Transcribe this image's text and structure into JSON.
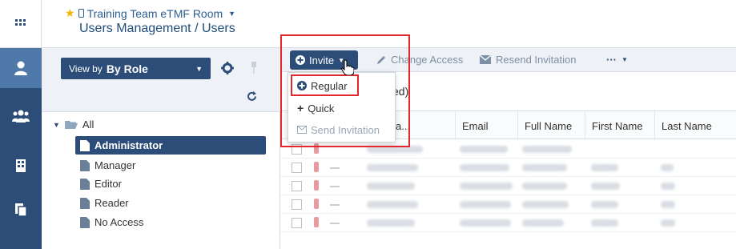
{
  "app": {
    "room_name": "Training Team eTMF Room",
    "page_title": "Users Management / Users"
  },
  "nav": {
    "items": [
      {
        "icon": "grid-icon"
      },
      {
        "icon": "user-icon",
        "active": true
      },
      {
        "icon": "users-group-icon"
      },
      {
        "icon": "building-icon"
      },
      {
        "icon": "documents-icon"
      }
    ]
  },
  "sidebar": {
    "viewby_label": "View by",
    "viewby_value": "By Role",
    "tree_root": "All",
    "roles": [
      "Administrator",
      "Manager",
      "Editor",
      "Reader",
      "No Access"
    ],
    "selected_role": "Administrator"
  },
  "toolbar": {
    "invite_label": "Invite",
    "change_access_label": "Change Access",
    "resend_label": "Resend Invitation",
    "more_label": "···"
  },
  "invite_menu": {
    "items": [
      "Regular",
      "Quick",
      "Send Invitation"
    ]
  },
  "grid": {
    "count_text": "ed)",
    "columns": [
      "a...",
      "Email",
      "Full Name",
      "First Name",
      "Last Name"
    ]
  },
  "colors": {
    "nav_bg": "#2c4d78",
    "accent": "#2c4d78",
    "highlight": "#e0282e",
    "star": "#f4b400"
  }
}
